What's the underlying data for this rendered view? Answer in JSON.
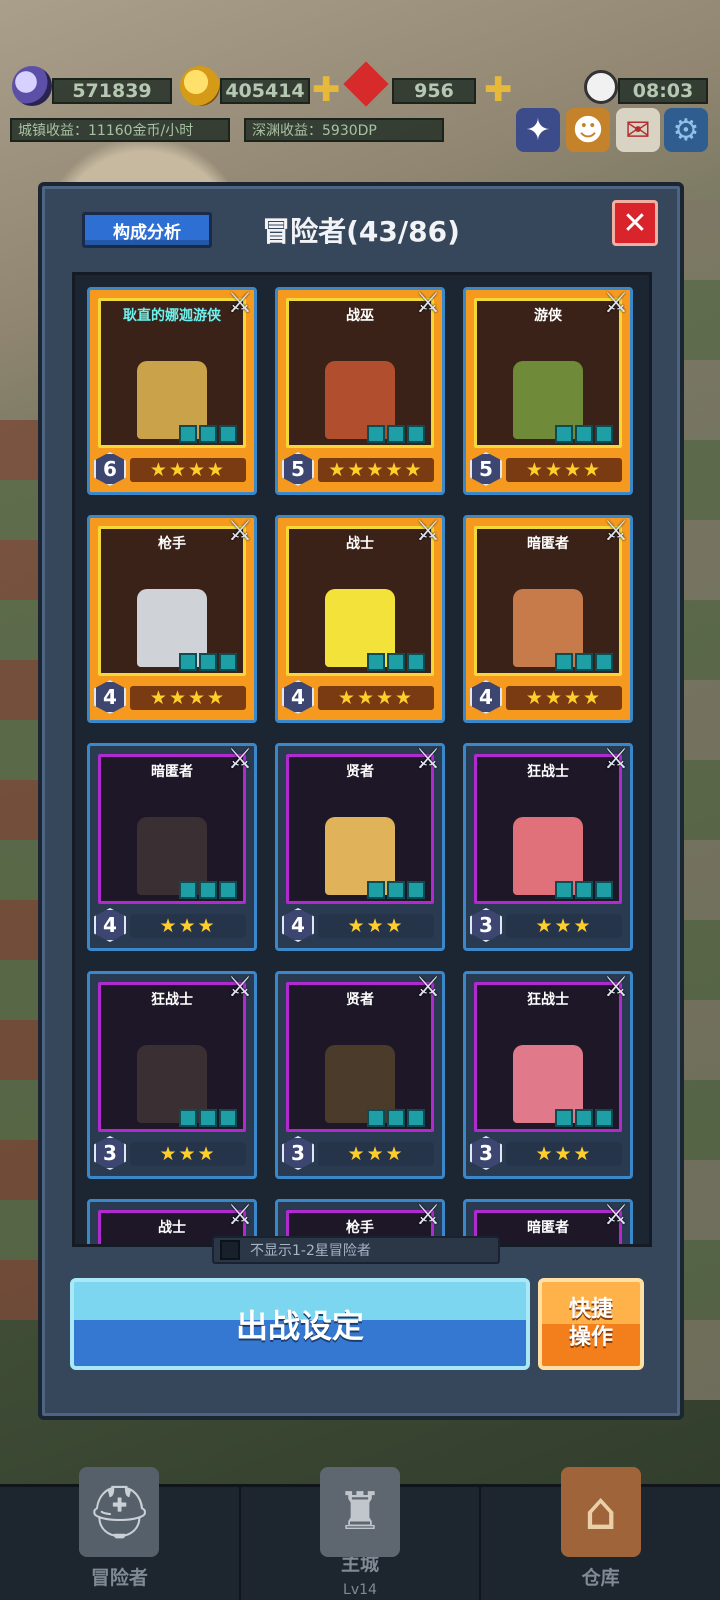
{
  "hud": {
    "moon_value": "571839",
    "gold_value": "405414",
    "gem_value": "956",
    "time": "08:03",
    "town_income": "城镇收益：11160金币/小时",
    "abyss_income": "深渊收益：5930DP",
    "plus": "✚"
  },
  "panel": {
    "title": "冒险者(43/86)",
    "analysis_label": "构成分析",
    "close_symbol": "✕",
    "filter_label": "不显示1-2星冒险者",
    "deploy_label": "出战设定",
    "quick_line1": "快捷",
    "quick_line2": "操作"
  },
  "cards": [
    {
      "name": "耿直的娜迦游侠",
      "level": "6",
      "stars": "★★★★",
      "rarity": "gold"
    },
    {
      "name": "战巫",
      "level": "5",
      "stars": "★★★★★",
      "rarity": "gold"
    },
    {
      "name": "游侠",
      "level": "5",
      "stars": "★★★★",
      "rarity": "gold"
    },
    {
      "name": "枪手",
      "level": "4",
      "stars": "★★★★",
      "rarity": "gold"
    },
    {
      "name": "战士",
      "level": "4",
      "stars": "★★★★",
      "rarity": "gold"
    },
    {
      "name": "暗匿者",
      "level": "4",
      "stars": "★★★★",
      "rarity": "gold"
    },
    {
      "name": "暗匿者",
      "level": "4",
      "stars": "★★★",
      "rarity": "purple"
    },
    {
      "name": "贤者",
      "level": "4",
      "stars": "★★★",
      "rarity": "purple"
    },
    {
      "name": "狂战士",
      "level": "3",
      "stars": "★★★",
      "rarity": "purple"
    },
    {
      "name": "狂战士",
      "level": "3",
      "stars": "★★★",
      "rarity": "purple"
    },
    {
      "name": "贤者",
      "level": "3",
      "stars": "★★★",
      "rarity": "purple"
    },
    {
      "name": "狂战士",
      "level": "3",
      "stars": "★★★",
      "rarity": "purple"
    },
    {
      "name": "战士",
      "level": "",
      "stars": "",
      "rarity": "purple"
    },
    {
      "name": "枪手",
      "level": "",
      "stars": "",
      "rarity": "purple"
    },
    {
      "name": "暗匿者",
      "level": "",
      "stars": "",
      "rarity": "purple"
    }
  ],
  "nav": {
    "adventurer": "冒险者",
    "main_city": "主城",
    "main_city_level": "Lv14",
    "warehouse": "仓库"
  },
  "icons": {
    "moon": "moon-icon",
    "coin": "coin-icon",
    "gem": "gem-icon",
    "clock": "clock-icon",
    "settings": "gear-icon"
  }
}
